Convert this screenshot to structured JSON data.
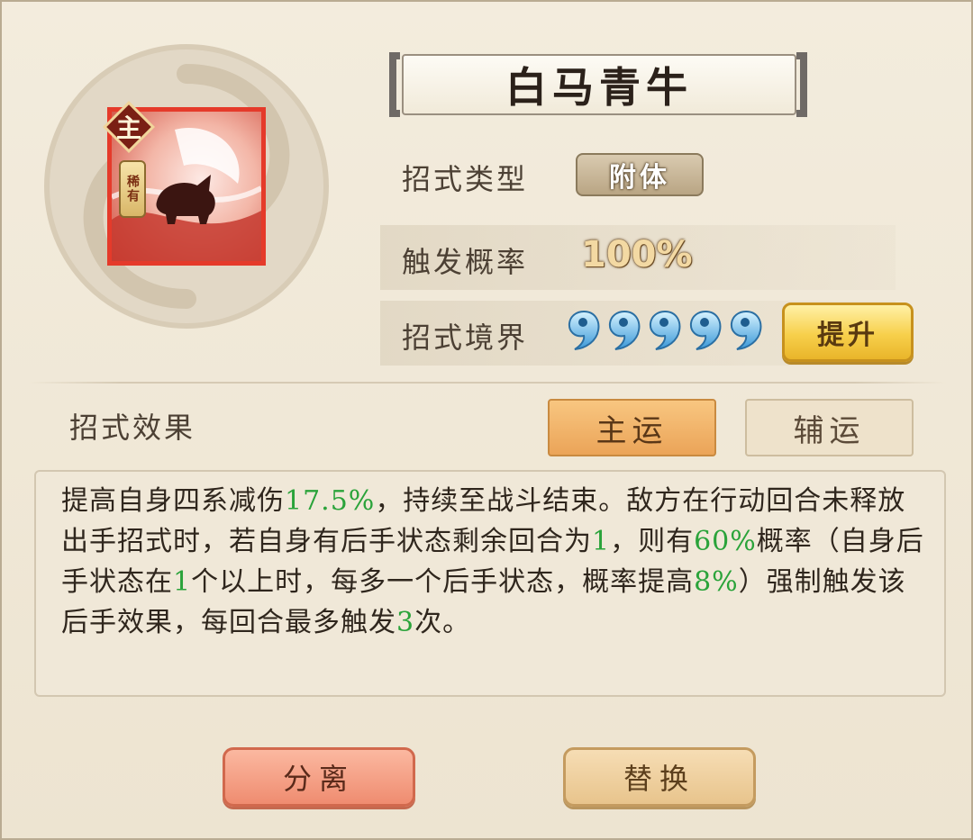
{
  "skill": {
    "name": "白马青牛",
    "badge_main": "主",
    "badge_rarity": "稀有"
  },
  "rows": {
    "type_label": "招式类型",
    "type_value": "附体",
    "rate_label": "触发概率",
    "rate_value": "100%",
    "realm_label": "招式境界",
    "realm_level": 5,
    "upgrade_label": "提升"
  },
  "effect": {
    "label": "招式效果",
    "tab_main": "主运",
    "tab_aux": "辅运",
    "selected_tab": "主运",
    "text": {
      "p1": "提高自身四系减伤",
      "v1": "17.5%",
      "p2": "，持续至战斗结束。敌方在行动回合未释放出手招式时，若自身有后手状态剩余回合为",
      "v2": "1",
      "p3": "，则有",
      "v3": "60%",
      "p4": "概率（自身后手状态在",
      "v4": "1",
      "p5": "个以上时，每多一个后手状态，概率提高",
      "v5": "8%",
      "p6": "）强制触发该后手效果，每回合最多触发",
      "v6": "3",
      "p7": "次。"
    }
  },
  "buttons": {
    "separate": "分离",
    "replace": "替换"
  },
  "colors": {
    "highlight": "#2aa33a",
    "card_border": "#e53a2a",
    "tab_active": "#eba458",
    "upgrade": "#f7d04b"
  },
  "icons": [
    "swirl-emblem-icon",
    "ox-skill-icon",
    "realm-drop-icon"
  ]
}
